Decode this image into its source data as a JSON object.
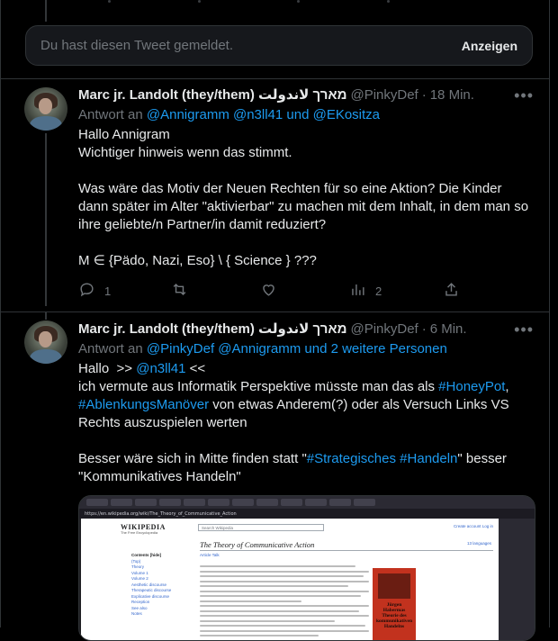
{
  "reported_notice": {
    "message": "Du hast diesen Tweet gemeldet.",
    "show_label": "Anzeigen"
  },
  "tweets": [
    {
      "display_name": "Marc jr. Landolt (they/them) מארך لاندولت",
      "handle": "@PinkyDef",
      "separator": "·",
      "time": "18 Min.",
      "reply_prefix": "Antwort an",
      "reply_to": "@Annigramm @n3ll41 und @EKositza",
      "text": "Hallo Annigram\nWichtiger hinweis wenn das stimmt.\n\nWas wäre das Motiv der Neuen Rechten für so eine Aktion? Die Kinder dann später im Alter \"aktivierbar\" zu machen mit dem Inhalt, in dem man so ihre geliebte/n Partner/in damit reduziert?\n\nM ∈ {Pädo, Nazi, Eso} \\ { Science } ???",
      "replies": "1",
      "retweets": "",
      "likes": "",
      "views": "2"
    },
    {
      "display_name": "Marc jr. Landolt (they/them) מארך لاندولت",
      "handle": "@PinkyDef",
      "separator": "·",
      "time": "6 Min.",
      "reply_prefix": "Antwort an",
      "reply_to": "@PinkyDef @Annigramm und 2 weitere Personen",
      "text_line1_a": "Hallo  >> ",
      "text_line1_mention": "@n3ll41",
      "text_line1_b": " <<",
      "text_line2_a": "ich vermute aus Informatik Perspektive müsste man das als ",
      "hashtag1": "#HoneyPot",
      "text_line2_b": ",",
      "hashtag2": "#AblenkungsManöver",
      "text_line3": " von etwas Anderem(?) oder als Versuch Links VS Rechts auszuspielen werten",
      "text_line4_a": "Besser wäre sich in Mitte finden statt \"",
      "hashtag3": "#Strategisches",
      "text_space": " ",
      "hashtag4": "#Handeln",
      "text_line4_b": "\" besser \"Kommunikatives Handeln\""
    }
  ],
  "media": {
    "url": "https://en.wikipedia.org/wiki/The_Theory_of_Communicative_Action",
    "wiki_logo": "WIKIPEDIA",
    "wiki_tagline": "The Free Encyclopedia",
    "wiki_search": "Search Wikipedia",
    "wiki_account": "Create account  Log in",
    "article_title": "The Theory of Communicative Action",
    "languages": "13 languages",
    "tabs": "Article  Talk",
    "toc_header": "Contents [hide]",
    "toc_items": [
      "(Top)",
      "Theory",
      "Volume 1",
      "Volume 2",
      "Aesthetic discourse",
      "Therapeutic discourse",
      "Explicative discourse",
      "Reception",
      "See also",
      "Notes"
    ],
    "book_title": "Jürgen Habermas Theorie des kommunikativen Handelns"
  },
  "icons": {
    "reply": "reply-icon",
    "retweet": "retweet-icon",
    "like": "heart-icon",
    "views": "views-icon",
    "share": "share-icon"
  }
}
